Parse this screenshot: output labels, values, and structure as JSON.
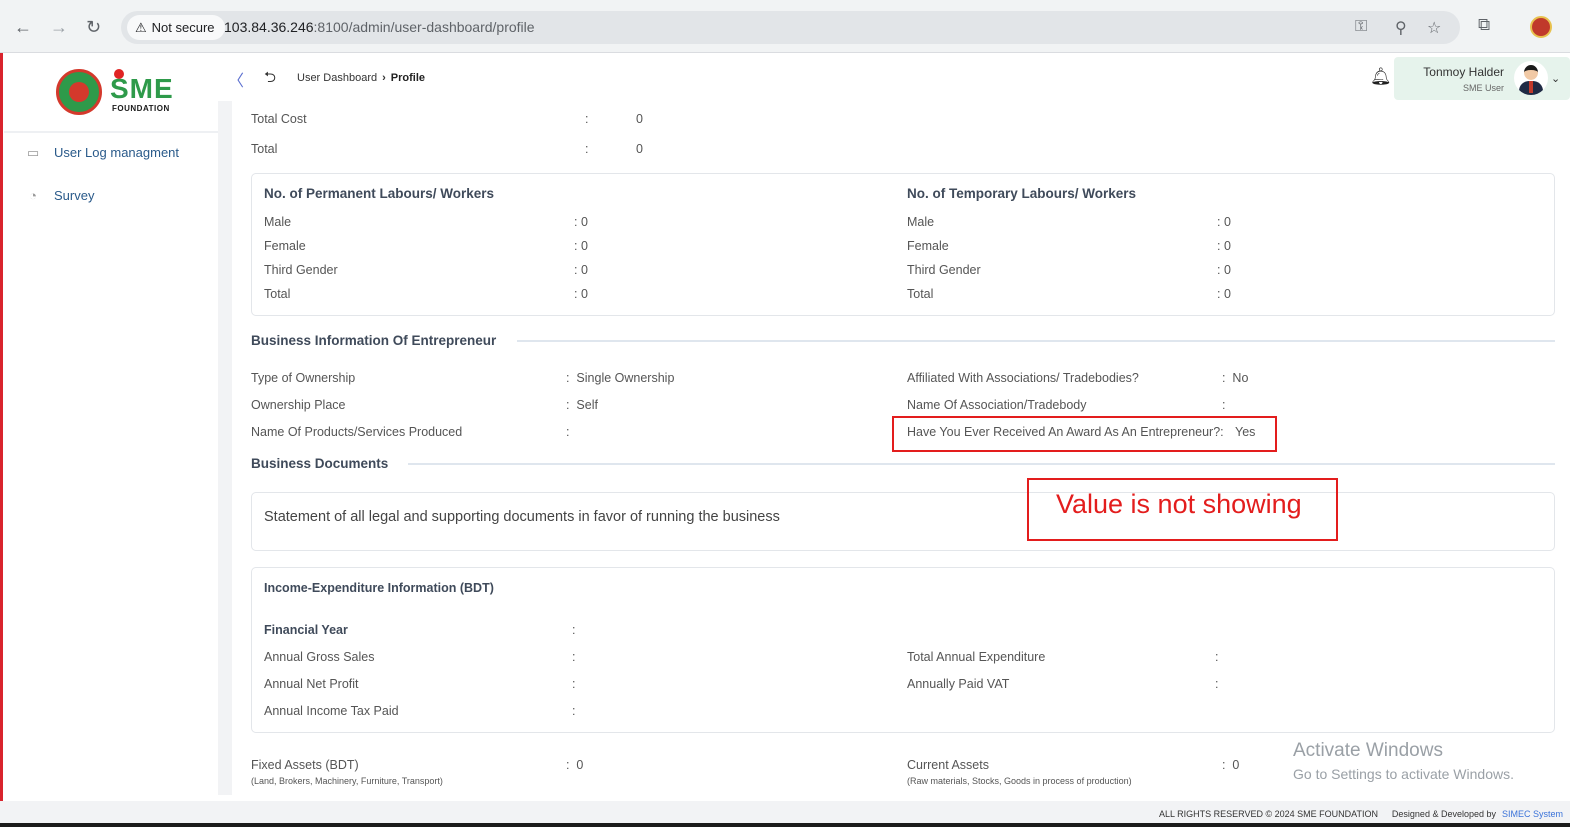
{
  "browser": {
    "security": "Not secure",
    "url_host": "103.84.36.246",
    "url_rest": ":8100/admin/user-dashboard/profile"
  },
  "sidebar": {
    "logo_text": "SME",
    "logo_sub": "FOUNDATION",
    "items": [
      {
        "label": "User Log managment",
        "icon": "log-icon"
      },
      {
        "label": "Survey",
        "icon": "pie-chart-icon"
      }
    ]
  },
  "header": {
    "breadcrumb_parent": "User Dashboard",
    "breadcrumb_current": "Profile",
    "user_name": "Tonmoy Halder",
    "user_role": "SME User"
  },
  "totals": [
    {
      "label": "Total Cost",
      "value": "0"
    },
    {
      "label": "Total",
      "value": "0"
    }
  ],
  "labour": {
    "permanent_title": "No. of Permanent Labours/ Workers",
    "temporary_title": "No. of Temporary Labours/ Workers",
    "rows": [
      {
        "label": "Male",
        "perm": "0",
        "temp": "0"
      },
      {
        "label": "Female",
        "perm": "0",
        "temp": "0"
      },
      {
        "label": "Third Gender",
        "perm": "0",
        "temp": "0"
      },
      {
        "label": "Total",
        "perm": "0",
        "temp": "0"
      }
    ]
  },
  "business_info": {
    "title": "Business Information Of Entrepreneur",
    "left": [
      {
        "label": "Type of Ownership",
        "value": "Single Ownership"
      },
      {
        "label": "Ownership Place",
        "value": "Self"
      },
      {
        "label": "Name Of Products/Services Produced",
        "value": ""
      }
    ],
    "right": [
      {
        "label": "Affiliated With Associations/ Tradebodies?",
        "value": "No"
      },
      {
        "label": "Name Of Association/Tradebody",
        "value": ""
      },
      {
        "label": "Have You Ever Received An Award As An Entrepreneur?:",
        "value": "Yes"
      }
    ]
  },
  "documents": {
    "title": "Business Documents",
    "statement": "Statement of all legal and supporting documents in favor of running the business"
  },
  "annotation": {
    "note": "Value is not showing",
    "color": "#e31d1d"
  },
  "income": {
    "title": "Income-Expenditure Information (BDT)",
    "financial_year": "Financial Year",
    "left": [
      "Annual Gross Sales",
      "Annual Net Profit",
      "Annual Income Tax Paid"
    ],
    "right": [
      "Total Annual Expenditure",
      "Annually Paid VAT"
    ]
  },
  "assets": {
    "fixed_label": "Fixed Assets (BDT)",
    "fixed_sub": "(Land, Brokers, Machinery, Furniture, Transport)",
    "fixed_value": "0",
    "current_label": "Current Assets",
    "current_sub": "(Raw materials, Stocks, Goods in process of production)",
    "current_value": "0"
  },
  "windows": {
    "line1": "Activate Windows",
    "line2": "Go to Settings to activate Windows."
  },
  "footer": {
    "rights": "ALL RIGHTS RESERVED © 2024 SME FOUNDATION",
    "designed": "Designed & Developed by",
    "company": "SIMEC System"
  },
  "colors": {
    "brand_green": "#2e9a4a",
    "brand_red": "#d4392c",
    "link_blue": "#2a5a8a"
  }
}
